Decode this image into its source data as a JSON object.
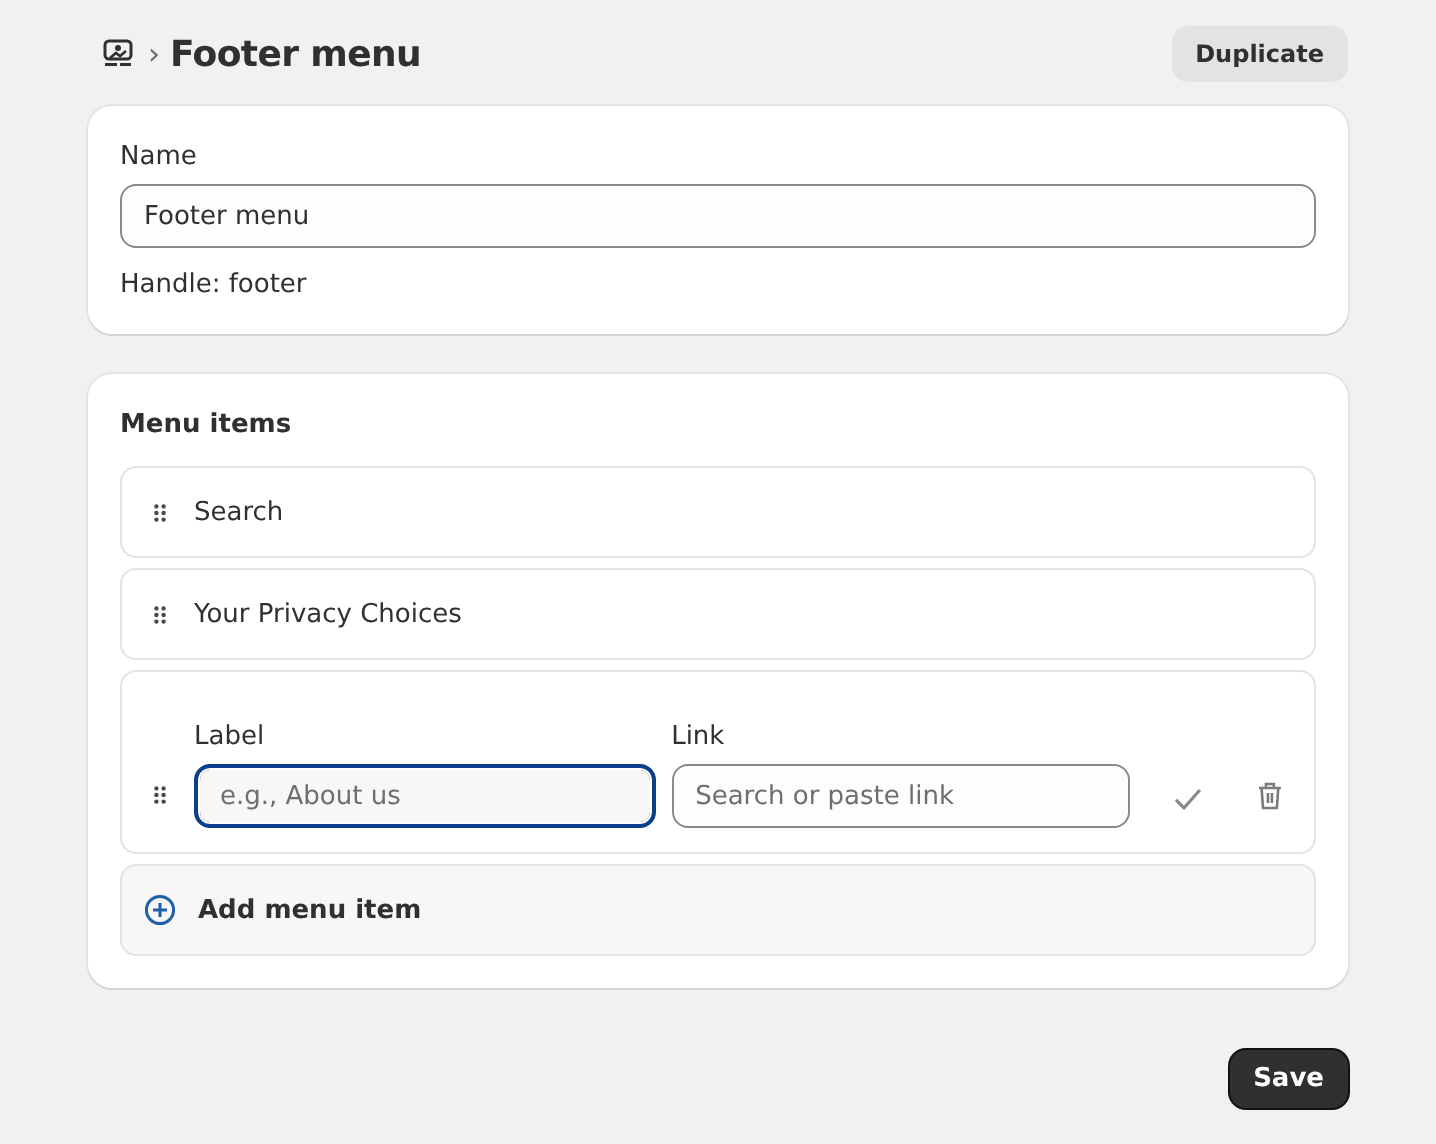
{
  "header": {
    "breadcrumb_separator": "›",
    "title": "Footer menu",
    "action": "Duplicate"
  },
  "details": {
    "name_label": "Name",
    "name_value": "Footer menu",
    "handle": "Handle: footer"
  },
  "menu": {
    "title": "Menu items",
    "items": [
      {
        "kind": "item",
        "title": "Search"
      },
      {
        "kind": "item",
        "title": "Your Privacy Choices"
      },
      {
        "kind": "editor",
        "label_caption": "Label",
        "label_placeholder": "e.g., About us",
        "label_focused": true,
        "link_caption": "Link",
        "link_placeholder": "Search or paste link"
      }
    ],
    "add_label": "Add menu item"
  },
  "save": "Save"
}
